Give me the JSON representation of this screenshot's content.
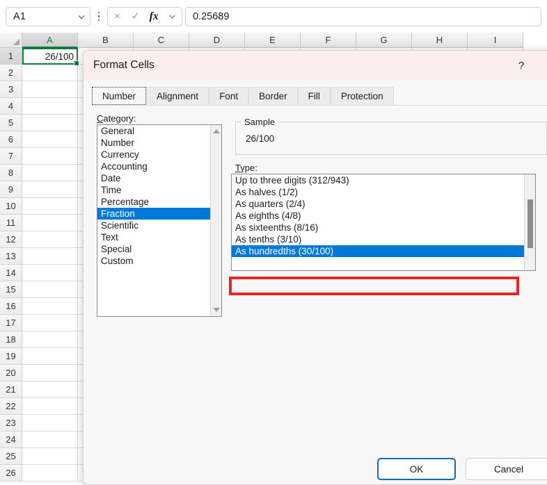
{
  "formula_bar": {
    "name_box_value": "A1",
    "name_box_chevron": "chevron-down-icon",
    "cancel_icon": "×",
    "enter_icon": "✓",
    "fx_icon": "fx",
    "fx_chevron": "⌄",
    "formula_value": "0.25689"
  },
  "grid": {
    "columns": [
      "A",
      "B",
      "C",
      "D",
      "E",
      "F",
      "G",
      "H",
      "I"
    ],
    "active_column": "A",
    "rows": [
      1,
      2,
      3,
      4,
      5,
      6,
      7,
      8,
      9,
      10,
      11,
      12,
      13,
      14,
      15,
      16,
      17,
      18,
      19,
      20,
      21,
      22,
      23,
      24,
      25,
      26
    ],
    "active_row": 1,
    "selected_cell": "A1",
    "selected_cell_value": "26/100"
  },
  "dialog": {
    "title": "Format Cells",
    "help_label": "?",
    "close_label": "✕",
    "tabs": [
      {
        "label": "Number",
        "active": true
      },
      {
        "label": "Alignment",
        "active": false
      },
      {
        "label": "Font",
        "active": false
      },
      {
        "label": "Border",
        "active": false
      },
      {
        "label": "Fill",
        "active": false
      },
      {
        "label": "Protection",
        "active": false
      }
    ],
    "category": {
      "label_accel": "C",
      "label_rest": "ategory:",
      "items": [
        "General",
        "Number",
        "Currency",
        "Accounting",
        "Date",
        "Time",
        "Percentage",
        "Fraction",
        "Scientific",
        "Text",
        "Special",
        "Custom"
      ],
      "selected": "Fraction"
    },
    "sample": {
      "legend": "Sample",
      "value": "26/100"
    },
    "type": {
      "label_accel": "T",
      "label_rest": "ype:",
      "items": [
        "Up to three digits (312/943)",
        "As halves (1/2)",
        "As quarters (2/4)",
        "As eighths (4/8)",
        "As sixteenths (8/16)",
        "As tenths (3/10)",
        "As hundredths (30/100)"
      ],
      "selected": "As hundredths (30/100)"
    },
    "buttons": {
      "ok": "OK",
      "cancel": "Cancel"
    }
  },
  "annotation": {
    "highlight_color": "#e8242a",
    "highlight_target": "As hundredths (30/100)"
  },
  "colors": {
    "selection_blue": "#0078d7",
    "excel_green": "#107c41",
    "titlebar_pink": "#faeeee",
    "primary_button_border": "#0f6cbd"
  }
}
